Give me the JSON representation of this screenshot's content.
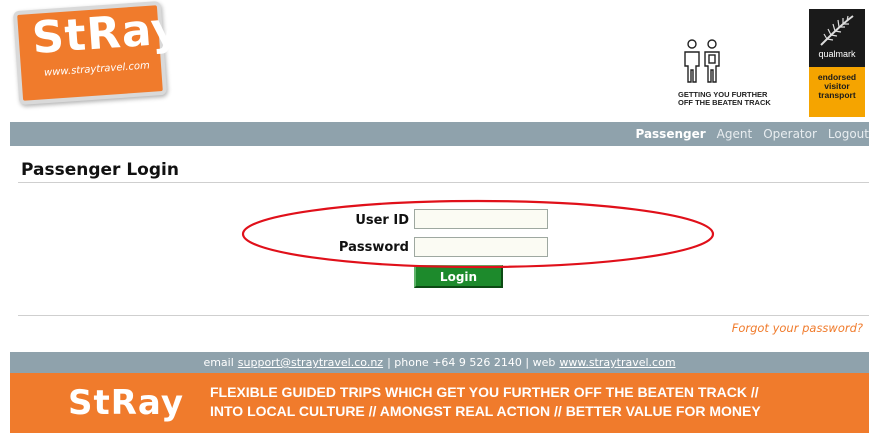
{
  "header": {
    "logo_text": "StRay",
    "logo_url": "www.straytravel.com",
    "tagline_line1": "GETTING YOU FURTHER",
    "tagline_line2": "OFF THE BEATEN TRACK",
    "qualmark_label": "qualmark",
    "qualmark_line1": "endorsed",
    "qualmark_line2": "visitor",
    "qualmark_line3": "transport"
  },
  "nav": {
    "items": [
      {
        "label": "Passenger",
        "active": true
      },
      {
        "label": "Agent",
        "active": false
      },
      {
        "label": "Operator",
        "active": false
      },
      {
        "label": "Logout",
        "active": false
      }
    ]
  },
  "page": {
    "title": "Passenger Login"
  },
  "form": {
    "userid_label": "User ID",
    "userid_value": "",
    "password_label": "Password",
    "password_value": "",
    "login_label": "Login",
    "forgot_label": "Forgot your password?"
  },
  "footer": {
    "email_prefix": "email",
    "email": "support@straytravel.co.nz",
    "phone": "| phone +64 9 526 2140 | web",
    "web": "www.straytravel.com",
    "banner_logo": "StRay",
    "slogan_line1": "FLEXIBLE GUIDED TRIPS WHICH GET YOU FURTHER OFF THE BEATEN TRACK //",
    "slogan_line2": "INTO LOCAL CULTURE // AMONGST REAL ACTION // BETTER VALUE FOR MONEY"
  },
  "colors": {
    "brand_orange": "#f07b2c",
    "nav_gray": "#8fa2ac",
    "button_green": "#1d8a2c",
    "annotation_red": "#e0101a",
    "qualmark_gold": "#f5a400"
  },
  "icons": [
    "stray-logo",
    "people-icon",
    "fern-icon"
  ]
}
